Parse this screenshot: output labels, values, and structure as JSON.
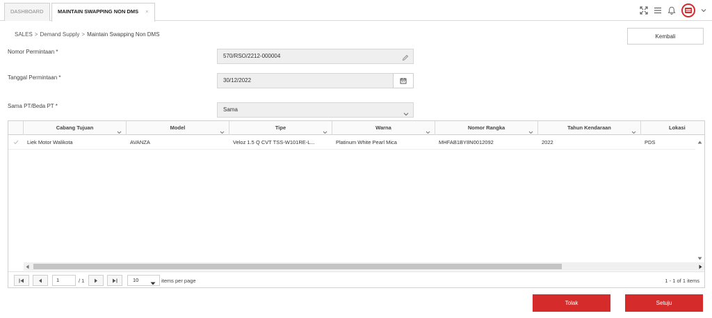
{
  "tabs": [
    {
      "label": "DASHBOARD"
    },
    {
      "label": "MAINTAIN SWAPPING NON DMS",
      "close": "×"
    }
  ],
  "header_icons": [
    "fullscreen-icon",
    "menu-icon",
    "bell-icon",
    "user-avatar"
  ],
  "breadcrumb": {
    "items": [
      "SALES",
      "Demand Supply",
      "Maintain Swapping Non DMS"
    ],
    "separator": ">"
  },
  "back_button": "Kembali",
  "form": {
    "nomor_permintaan": {
      "label": "Nomor Permintaan *",
      "value": "570/RSO/2212-000004"
    },
    "tanggal_permintaan": {
      "label": "Tanggal Permintaan *",
      "value": "30/12/2022"
    },
    "sama_beda": {
      "label": "Sama PT/Beda PT *",
      "value": "Sama"
    }
  },
  "grid": {
    "columns": [
      "Cabang Tujuan",
      "Model",
      "Tipe",
      "Warna",
      "Nomor Rangka",
      "Tahun Kendaraan",
      "Lokasi"
    ],
    "rows": [
      [
        "Liek Motor Walikota",
        "AVANZA",
        "Veloz 1.5 Q CVT TSS-W101RE-L...",
        "Platinum White Pearl Mica",
        "MHFAB1BY8N0012092",
        "2022",
        "PDS"
      ]
    ]
  },
  "pager": {
    "page": "1",
    "of_pages": "/ 1",
    "page_size": "10",
    "per_page_label": "items per page",
    "count_text": "1 - 1 of 1 items"
  },
  "actions": {
    "reject": "Tolak",
    "approve": "Setuju"
  },
  "colors": {
    "accent_red": "#d52b2b",
    "field_bg": "#efefef"
  }
}
